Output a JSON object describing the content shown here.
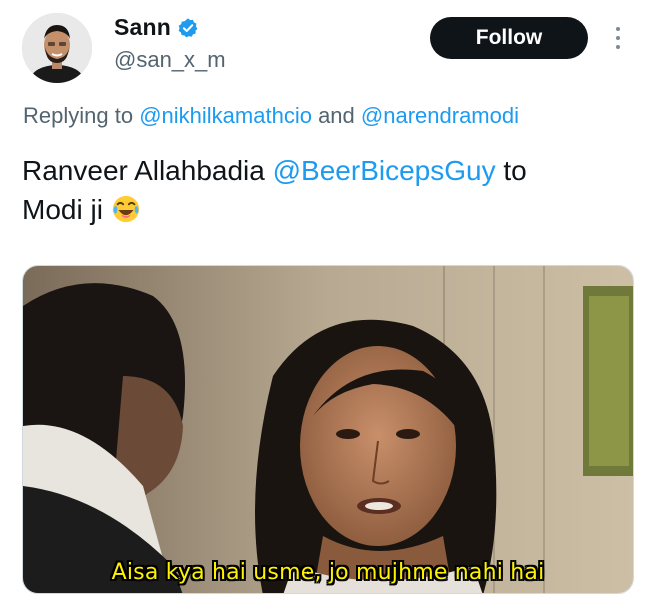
{
  "author": {
    "display_name": "Sann",
    "handle": "@san_x_m",
    "verified": true,
    "avatar_icon": "profile-photo-icon"
  },
  "actions": {
    "follow_label": "Follow",
    "more_icon": "more-vertical-icon"
  },
  "replying": {
    "prefix": "Replying to",
    "mention_1": "@nikhilkamathcio",
    "conjunction": "and",
    "mention_2": "@narendramodi"
  },
  "tweet": {
    "text_before": "Ranveer Allahbadia",
    "mention": "@BeerBicepsGuy",
    "text_after": "to",
    "line2": "Modi ji",
    "emoji": "face-with-tears-of-joy-icon"
  },
  "media": {
    "subtitle": "Aisa kya hai usme, jo mujhme nahi hai"
  },
  "colors": {
    "link": "#1d9bf0",
    "secondary_text": "#536471",
    "button_bg": "#0f1419",
    "verified": "#1d9bf0",
    "subtitle": "#fff200"
  }
}
